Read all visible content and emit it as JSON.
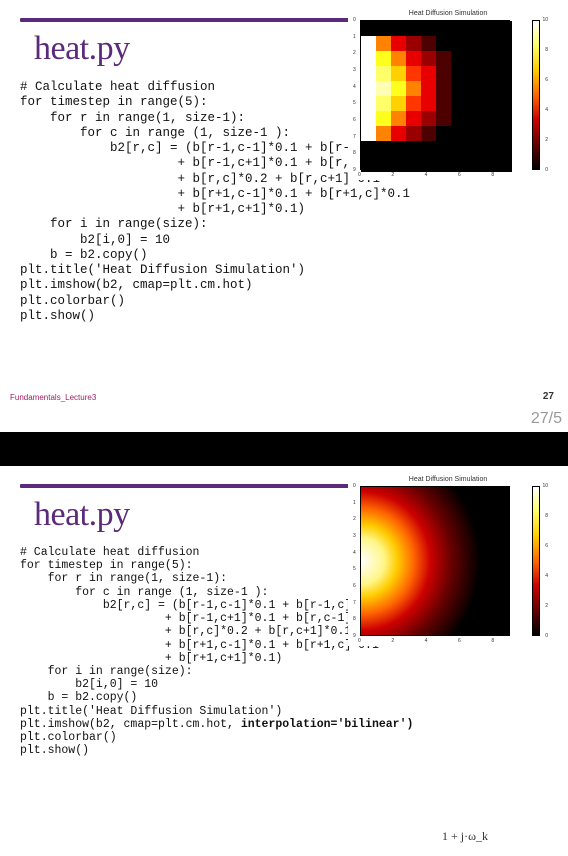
{
  "slide1": {
    "title": "heat.py",
    "footer_src": "Fundamentals_Lecture3",
    "footer_num": "27",
    "page_pos": "27/5",
    "code": [
      "# Calculate heat diffusion",
      "for timestep in range(5):",
      "    for r in range(1, size-1):",
      "        for c in range (1, size-1 ):",
      "            b2[r,c] = (b[r-1,c-1]*0.1 + b[r-1,c]*0.1",
      "                     + b[r-1,c+1]*0.1 + b[r,c-1]*0.1",
      "                     + b[r,c]*0.2 + b[r,c+1]*0.1",
      "                     + b[r+1,c-1]*0.1 + b[r+1,c]*0.1",
      "                     + b[r+1,c+1]*0.1)",
      "    for i in range(size):",
      "        b2[i,0] = 10",
      "    b = b2.copy()",
      "plt.title('Heat Diffusion Simulation')",
      "plt.imshow(b2, cmap=plt.cm.hot)",
      "plt.colorbar()",
      "plt.show()"
    ]
  },
  "slide2": {
    "title": "heat.py",
    "code": [
      "# Calculate heat diffusion",
      "for timestep in range(5):",
      "    for r in range(1, size-1):",
      "        for c in range (1, size-1 ):",
      "            b2[r,c] = (b[r-1,c-1]*0.1 + b[r-1,c]*0.1",
      "                     + b[r-1,c+1]*0.1 + b[r,c-1]*0.1",
      "                     + b[r,c]*0.2 + b[r,c+1]*0.1",
      "                     + b[r+1,c-1]*0.1 + b[r+1,c]*0.1",
      "                     + b[r+1,c+1]*0.1)",
      "    for i in range(size):",
      "        b2[i,0] = 10",
      "    b = b2.copy()",
      "plt.title('Heat Diffusion Simulation')"
    ],
    "code_bold": "plt.imshow(b2, cmap=plt.cm.hot, interpolation='bilinear')",
    "code_tail": [
      "plt.colorbar()",
      "plt.show()"
    ],
    "annot": "1 + j·ω_k"
  },
  "chart_common": {
    "title": "Heat Diffusion Simulation",
    "xlabel": "",
    "ylabel": "",
    "xticks": [
      0,
      2,
      4,
      6,
      8
    ],
    "yticks": [
      0,
      1,
      2,
      3,
      4,
      5,
      6,
      7,
      8,
      9
    ],
    "cb_min": 0,
    "cb_max": 10,
    "cb_ticks": [
      0,
      2,
      4,
      6,
      8,
      10
    ]
  },
  "chart_data": [
    {
      "type": "heatmap",
      "rendering": "nearest",
      "title": "Heat Diffusion Simulation",
      "cmap": "hot",
      "xlim": [
        0,
        9
      ],
      "ylim": [
        0,
        9
      ],
      "values_by_row": [
        [
          0,
          0,
          0,
          0,
          0,
          0,
          0,
          0,
          0,
          0
        ],
        [
          10,
          5,
          3,
          2,
          1,
          0,
          0,
          0,
          0,
          0
        ],
        [
          10,
          7,
          5,
          3,
          2,
          1,
          0,
          0,
          0,
          0
        ],
        [
          10,
          8,
          6,
          4,
          3,
          1,
          0,
          0,
          0,
          0
        ],
        [
          10,
          9,
          7,
          5,
          3,
          1,
          0,
          0,
          0,
          0
        ],
        [
          10,
          8,
          6,
          4,
          3,
          1,
          0,
          0,
          0,
          0
        ],
        [
          10,
          7,
          5,
          3,
          2,
          1,
          0,
          0,
          0,
          0
        ],
        [
          10,
          5,
          3,
          2,
          1,
          0,
          0,
          0,
          0,
          0
        ],
        [
          0,
          0,
          0,
          0,
          0,
          0,
          0,
          0,
          0,
          0
        ],
        [
          0,
          0,
          0,
          0,
          0,
          0,
          0,
          0,
          0,
          0
        ]
      ]
    },
    {
      "type": "heatmap",
      "rendering": "bilinear",
      "title": "Heat Diffusion Simulation",
      "cmap": "hot",
      "xlim": [
        0,
        9
      ],
      "ylim": [
        0,
        9
      ],
      "values_by_row": [
        [
          0,
          0,
          0,
          0,
          0,
          0,
          0,
          0,
          0,
          0
        ],
        [
          10,
          5,
          3,
          2,
          1,
          0,
          0,
          0,
          0,
          0
        ],
        [
          10,
          7,
          5,
          3,
          2,
          1,
          0,
          0,
          0,
          0
        ],
        [
          10,
          8,
          6,
          4,
          3,
          1,
          0,
          0,
          0,
          0
        ],
        [
          10,
          9,
          7,
          5,
          3,
          1,
          0,
          0,
          0,
          0
        ],
        [
          10,
          8,
          6,
          4,
          3,
          1,
          0,
          0,
          0,
          0
        ],
        [
          10,
          7,
          5,
          3,
          2,
          1,
          0,
          0,
          0,
          0
        ],
        [
          10,
          5,
          3,
          2,
          1,
          0,
          0,
          0,
          0,
          0
        ],
        [
          0,
          0,
          0,
          0,
          0,
          0,
          0,
          0,
          0,
          0
        ],
        [
          0,
          0,
          0,
          0,
          0,
          0,
          0,
          0,
          0,
          0
        ]
      ]
    }
  ]
}
